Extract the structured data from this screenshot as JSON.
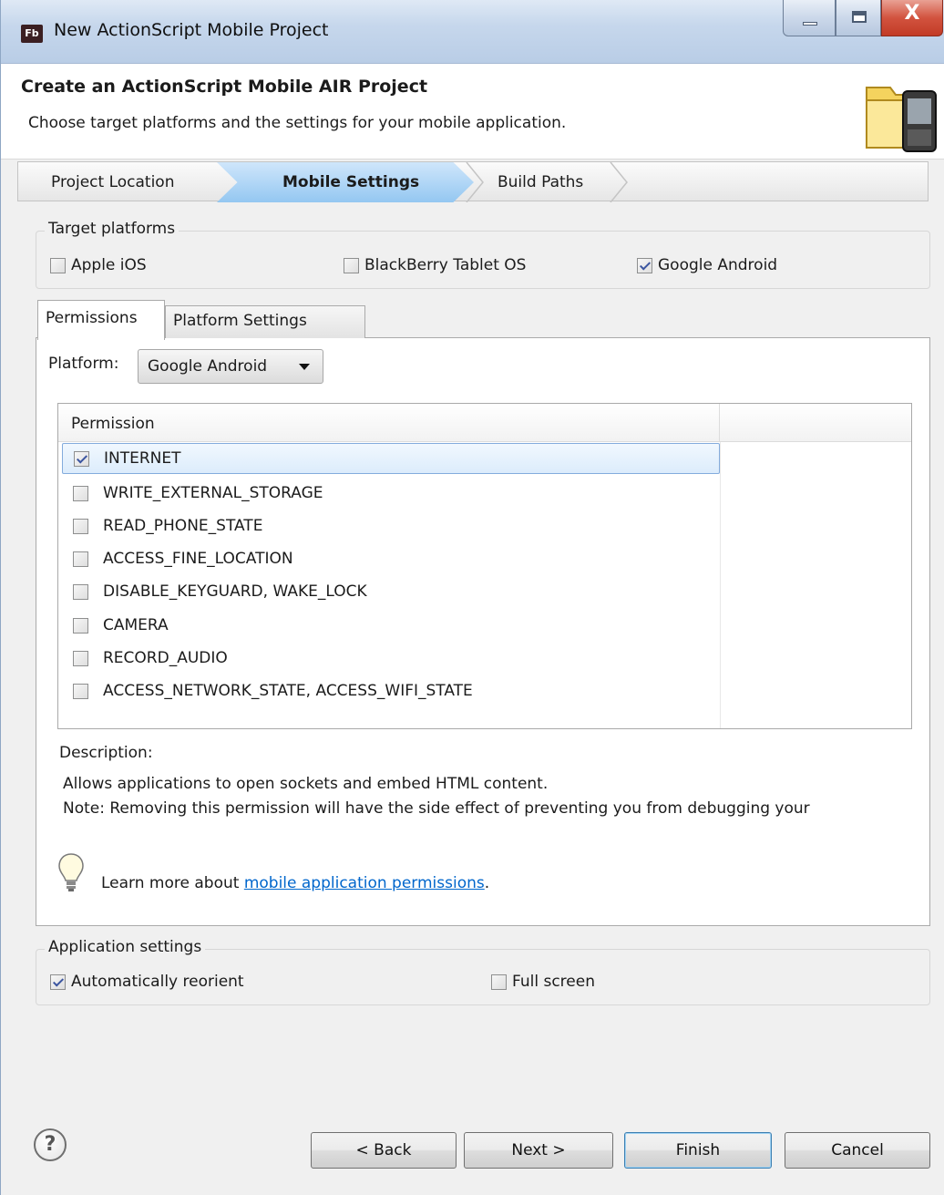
{
  "window": {
    "title": "New ActionScript Mobile Project",
    "app_icon_text": "Fb",
    "controls": {
      "minimize": "minimize",
      "maximize": "maximize",
      "close": "X"
    }
  },
  "header": {
    "title": "Create an ActionScript Mobile AIR Project",
    "subtitle": "Choose target platforms and the settings for your mobile application.",
    "icon": "folder-mobile-icon"
  },
  "steps": [
    {
      "label": "Project Location",
      "active": false
    },
    {
      "label": "Mobile Settings",
      "active": true
    },
    {
      "label": "Build Paths",
      "active": false
    }
  ],
  "target_platforms": {
    "label": "Target platforms",
    "options": [
      {
        "label": "Apple iOS",
        "checked": false
      },
      {
        "label": "BlackBerry Tablet OS",
        "checked": false
      },
      {
        "label": "Google Android",
        "checked": true
      }
    ]
  },
  "tabs": [
    {
      "label": "Permissions",
      "active": true
    },
    {
      "label": "Platform Settings",
      "active": false
    }
  ],
  "platform": {
    "label": "Platform:",
    "selected": "Google Android"
  },
  "permissions": {
    "column_header": "Permission",
    "rows": [
      {
        "label": "INTERNET",
        "checked": true,
        "selected": true
      },
      {
        "label": "WRITE_EXTERNAL_STORAGE",
        "checked": false
      },
      {
        "label": "READ_PHONE_STATE",
        "checked": false
      },
      {
        "label": "ACCESS_FINE_LOCATION",
        "checked": false
      },
      {
        "label": "DISABLE_KEYGUARD, WAKE_LOCK",
        "checked": false
      },
      {
        "label": "CAMERA",
        "checked": false
      },
      {
        "label": "RECORD_AUDIO",
        "checked": false
      },
      {
        "label": "ACCESS_NETWORK_STATE, ACCESS_WIFI_STATE",
        "checked": false
      }
    ]
  },
  "description": {
    "label": "Description:",
    "line1": "Allows applications to open sockets and embed HTML content.",
    "line2": "Note: Removing this permission will have the side effect of preventing you from debugging your"
  },
  "learn_more": {
    "prefix": "Learn more about ",
    "link": "mobile application permissions",
    "suffix": "."
  },
  "application_settings": {
    "label": "Application settings",
    "options": [
      {
        "label": "Automatically reorient",
        "checked": true
      },
      {
        "label": "Full screen",
        "checked": false
      }
    ]
  },
  "buttons": {
    "help": "?",
    "back": "< Back",
    "next": "Next >",
    "finish": "Finish",
    "cancel": "Cancel"
  }
}
